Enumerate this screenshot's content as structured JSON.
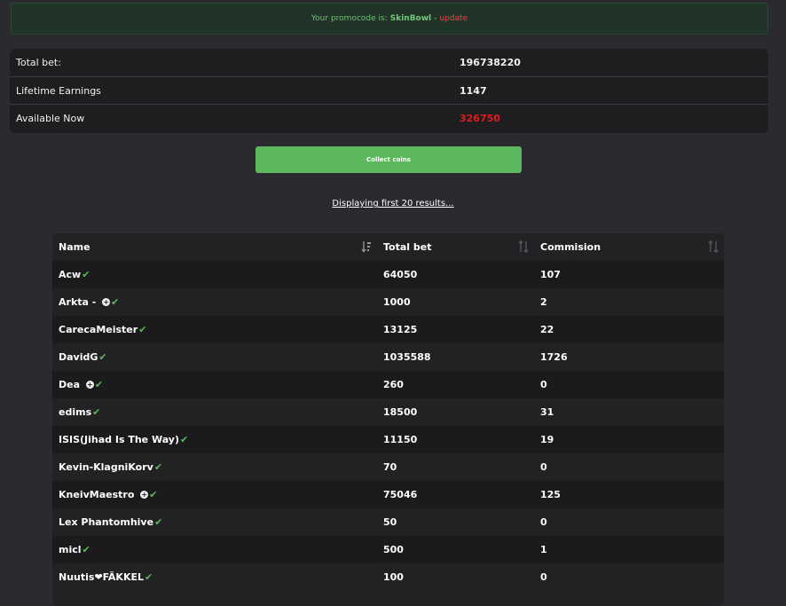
{
  "promo": {
    "prefix": "Your promocode is:",
    "code": "SkinBowl",
    "separator": "-",
    "update_label": "update"
  },
  "stats": [
    {
      "label": "Total bet:",
      "value": "196738220",
      "highlight": false
    },
    {
      "label": "Lifetime Earnings",
      "value": "1147",
      "highlight": false
    },
    {
      "label": "Available Now",
      "value": "326750",
      "highlight": true
    }
  ],
  "collect_button": "Collect coins",
  "displaying_text": "Displaying first 20 results...",
  "table": {
    "headers": [
      "Name",
      "Total bet",
      "Commision"
    ],
    "rows": [
      {
        "name": "Acw",
        "badge": false,
        "total": "64050",
        "commission": "107"
      },
      {
        "name": "Arkta - ",
        "badge": true,
        "total": "1000",
        "commission": "2"
      },
      {
        "name": "CarecaMeister",
        "badge": false,
        "total": "13125",
        "commission": "22"
      },
      {
        "name": "DavidG",
        "badge": false,
        "total": "1035588",
        "commission": "1726"
      },
      {
        "name": "Dea ",
        "badge": true,
        "total": "260",
        "commission": "0"
      },
      {
        "name": "edims",
        "badge": false,
        "total": "18500",
        "commission": "31"
      },
      {
        "name": "ISIS(Jihad Is The Way)",
        "badge": false,
        "total": "11150",
        "commission": "19"
      },
      {
        "name": "Kevin-KlagniKorv",
        "badge": false,
        "total": "70",
        "commission": "0"
      },
      {
        "name": "KneivMaestro ",
        "badge": true,
        "total": "75046",
        "commission": "125"
      },
      {
        "name": "Lex Phantomhive",
        "badge": false,
        "total": "50",
        "commission": "0"
      },
      {
        "name": "micl",
        "badge": false,
        "total": "500",
        "commission": "1"
      },
      {
        "name": "Nuutis❤FÄKKEL",
        "badge": false,
        "total": "100",
        "commission": "0"
      }
    ]
  },
  "colors": {
    "background": "#2b2a2f",
    "accent_green": "#5cb85c",
    "alert_red": "#e31b1b"
  }
}
